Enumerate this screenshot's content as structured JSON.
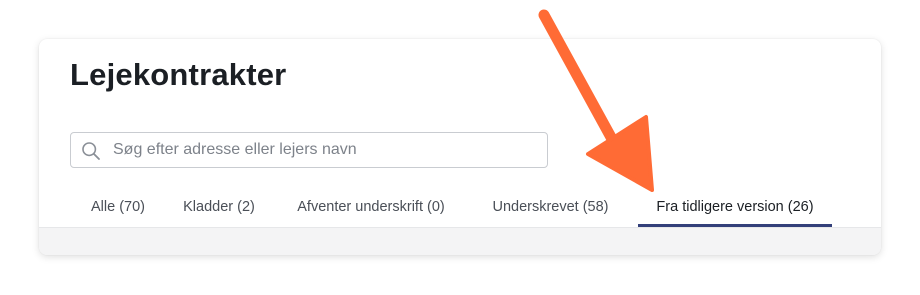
{
  "page": {
    "title": "Lejekontrakter"
  },
  "search": {
    "placeholder": "Søg efter adresse eller lejers navn",
    "value": ""
  },
  "tabs": [
    {
      "label": "Alle (70)",
      "active": false
    },
    {
      "label": "Kladder (2)",
      "active": false
    },
    {
      "label": "Afventer underskrift (0)",
      "active": false
    },
    {
      "label": "Underskrevet (58)",
      "active": false
    },
    {
      "label": "Fra tidligere version (26)",
      "active": true
    }
  ],
  "icons": {
    "search": "search-icon",
    "annotation": "arrow-pointer-icon"
  },
  "colors": {
    "active_tab_underline": "#33407a",
    "annotation_arrow": "#ff6b35",
    "title_text": "#1b1f24",
    "tab_text": "#4a4f57"
  }
}
